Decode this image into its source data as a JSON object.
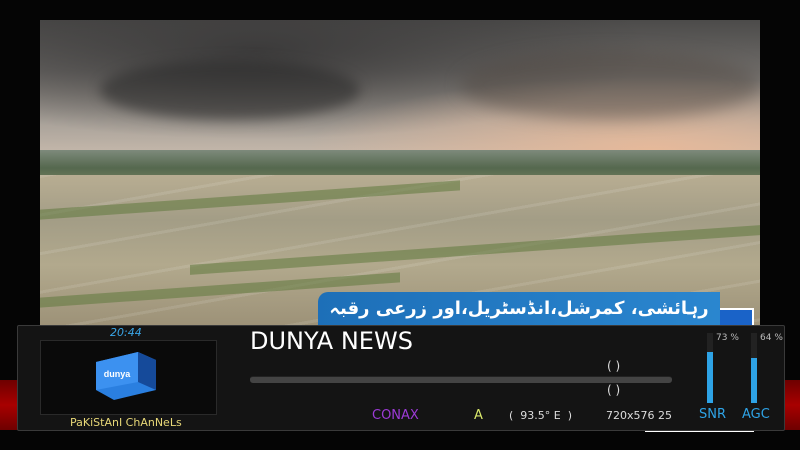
{
  "video": {
    "urdu_caption": "رہائشی، کمرشل،انڈسٹریل،اور زرعی رقبہ"
  },
  "osd": {
    "time": "20:44",
    "channel_name": "DUNYA NEWS",
    "logo_text": "dunya",
    "group_label": "PaKiStAnI ChAnNeLs",
    "program_slot_1": "(                    )",
    "program_slot_2": "(                    )",
    "encryption": "CONAX",
    "audio_flag": "A",
    "satellite_position": "(  93.5° E  )",
    "resolution": "720x576 25",
    "signal": {
      "snr_label": "SNR",
      "snr_percent": "73 %",
      "snr_value": 73,
      "agc_label": "AGC",
      "agc_percent": "64 %",
      "agc_value": 64
    },
    "progress_value": 0,
    "colors": {
      "accent_blue": "#2ea3e6",
      "conax_purple": "#9c3ad6",
      "audio_yellow": "#d9e86b",
      "group_yellow": "#e8d878"
    }
  }
}
